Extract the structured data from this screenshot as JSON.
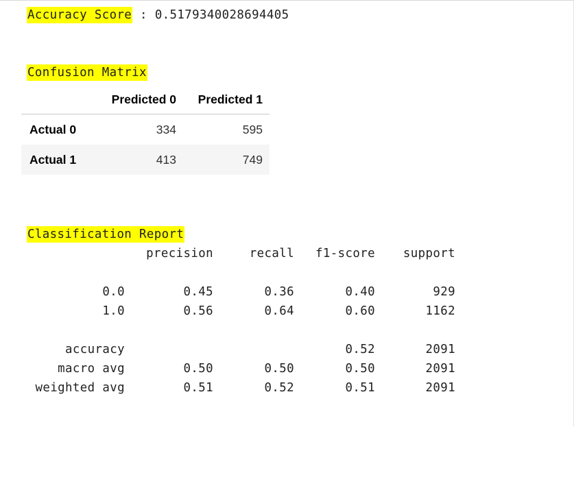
{
  "accuracy_score": {
    "label": "Accuracy Score",
    "separator": " : ",
    "value": "0.5179340028694405"
  },
  "confusion_matrix": {
    "heading": "Confusion Matrix",
    "columns": [
      "",
      "Predicted 0",
      "Predicted 1"
    ],
    "rows": [
      {
        "label": "Actual 0",
        "values": [
          "334",
          "595"
        ]
      },
      {
        "label": "Actual 1",
        "values": [
          "413",
          "749"
        ]
      }
    ]
  },
  "classification_report": {
    "heading": "Classification Report",
    "headers": [
      "precision",
      "recall",
      "f1-score",
      "support"
    ],
    "rows": [
      {
        "label": "0.0",
        "precision": "0.45",
        "recall": "0.36",
        "f1": "0.40",
        "support": "929"
      },
      {
        "label": "1.0",
        "precision": "0.56",
        "recall": "0.64",
        "f1": "0.60",
        "support": "1162"
      },
      {
        "label": "accuracy",
        "precision": "",
        "recall": "",
        "f1": "0.52",
        "support": "2091"
      },
      {
        "label": "macro avg",
        "precision": "0.50",
        "recall": "0.50",
        "f1": "0.50",
        "support": "2091"
      },
      {
        "label": "weighted avg",
        "precision": "0.51",
        "recall": "0.52",
        "f1": "0.51",
        "support": "2091"
      }
    ]
  },
  "colors": {
    "highlight": "#ffff00",
    "row_stripe": "#f5f5f5",
    "text": "#212121"
  }
}
